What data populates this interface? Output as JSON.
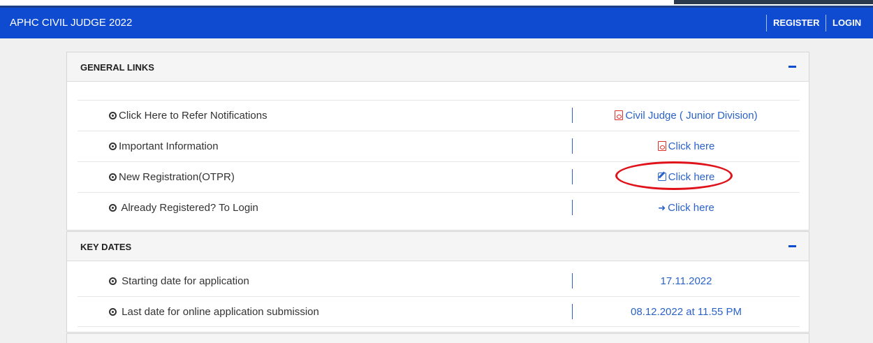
{
  "navbar": {
    "title": "APHC CIVIL JUDGE 2022",
    "register_label": "REGISTER",
    "login_label": "LOGIN",
    "color": "#0f4bd0"
  },
  "general_links": {
    "title": "GENERAL LINKS",
    "rows": [
      {
        "label": "Click Here to Refer Notifications",
        "link": "Civil Judge ( Junior Division)",
        "icon": "pdf-icon"
      },
      {
        "label": "Important Information",
        "link": "Click here",
        "icon": "pdf-icon"
      },
      {
        "label": "New Registration(OTPR)",
        "link": "Click here",
        "icon": "edit-icon"
      },
      {
        "label": " Already Registered? To Login",
        "link": "Click here",
        "icon": "signin-icon"
      }
    ]
  },
  "key_dates": {
    "title": "KEY DATES",
    "rows": [
      {
        "label": " Starting date for application",
        "value": "17.11.2022"
      },
      {
        "label": " Last date for online application submission",
        "value": "08.12.2022 at 11.55 PM"
      }
    ]
  },
  "colors": {
    "link": "#2a62c9",
    "pdf_icon": "#e0302a",
    "highlight": "#e0121a"
  }
}
